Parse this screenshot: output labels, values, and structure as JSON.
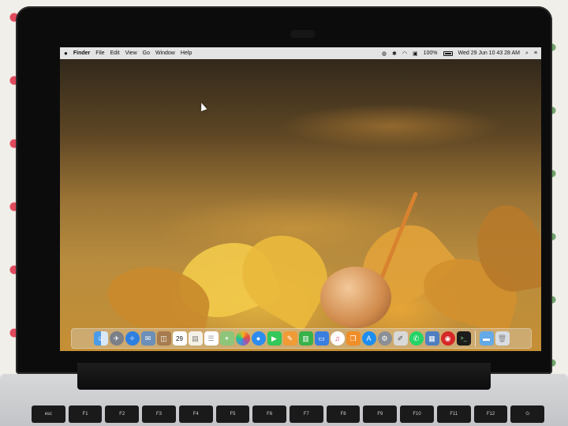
{
  "menubar": {
    "app": "Finder",
    "items": [
      "File",
      "Edit",
      "View",
      "Go",
      "Window",
      "Help"
    ],
    "battery": "100%",
    "datetime": "Wed 29 Jun  10 43 28 AM"
  },
  "dock": {
    "calendar_day": "29"
  },
  "keyboard": {
    "keys": [
      "esc",
      "F1",
      "F2",
      "F3",
      "F4",
      "F5",
      "F6",
      "F7",
      "F8",
      "F9",
      "F10",
      "F11",
      "F12",
      "⏻"
    ]
  }
}
